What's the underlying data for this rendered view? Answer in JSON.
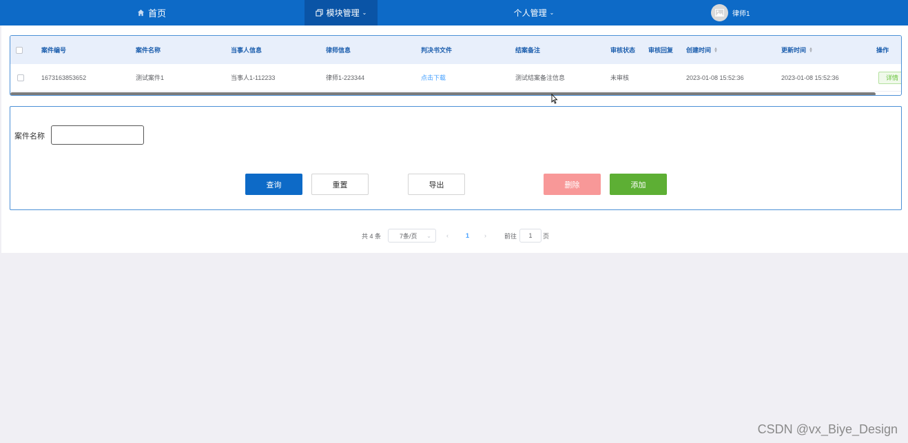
{
  "nav": {
    "home_label": "首页",
    "module_label": "模块管理",
    "personal_label": "个人管理",
    "user_name": "律师1"
  },
  "table": {
    "headers": {
      "case_no": "案件编号",
      "case_name": "案件名称",
      "party_info": "当事人信息",
      "lawyer_info": "律师信息",
      "judgment_file": "判决书文件",
      "closing_note": "结案备注",
      "review_status": "审核状态",
      "review_reply": "审核回复",
      "created_time": "创建时间",
      "updated_time": "更新时间",
      "action": "操作"
    },
    "rows": [
      {
        "case_no": "1673163853652",
        "case_name": "测试案件1",
        "party_info": "当事人1-112233",
        "lawyer_info": "律师1-223344",
        "judgment_file": "点击下载",
        "closing_note": "测试结案备注信息",
        "review_status": "未审核",
        "review_reply": "",
        "created_time": "2023-01-08 15:52:36",
        "updated_time": "2023-01-08 15:52:36",
        "action": "详情"
      }
    ]
  },
  "search": {
    "case_name_label": "案件名称",
    "case_name_value": "",
    "query_label": "查询",
    "reset_label": "重置",
    "export_label": "导出",
    "delete_label": "删除",
    "add_label": "添加"
  },
  "pagination": {
    "total_text": "共 4 条",
    "page_size": "7条/页",
    "current_page": "1",
    "goto_prefix": "前往",
    "goto_value": "1",
    "goto_suffix": "页"
  },
  "watermark": "CSDN @vx_Biye_Design",
  "colors": {
    "nav_bg": "#0d6ac7",
    "nav_active": "#0a54a6",
    "primary": "#0d6ac7",
    "danger": "#f89898",
    "success": "#5daf34",
    "link": "#409eff"
  }
}
